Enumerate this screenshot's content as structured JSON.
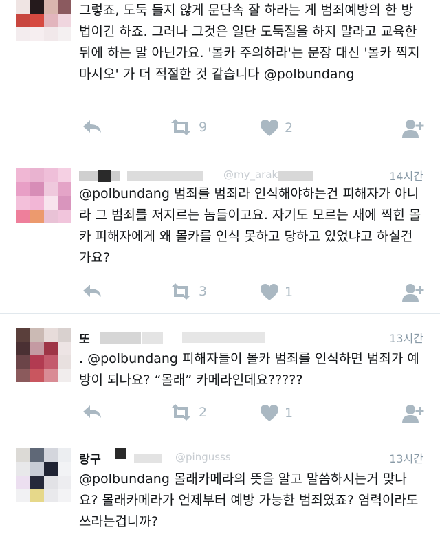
{
  "tweets": [
    {
      "text": "그렇죠, 도둑 들지 않게 문단속 잘 하라는 게 범죄예방의 한 방법이긴 하죠. 그러나 그것은 일단 도둑질을 하지 말라고 교육한 뒤에 하는 말 아닌가요. '몰카 주의하라'는 문장 대신 '몰카 찍지 마시오' 가 더 적절한 것 같습니다 @polbundang",
      "retweets": "9",
      "likes": "2"
    },
    {
      "name": "",
      "handle": "@my_arak",
      "time": "14시간",
      "text": "@polbundang 범죄를 범죄라 인식해야하는건 피해자가 아니라 그 범죄를 저지르는 놈들이고요. 자기도 모르는 새에 찍힌 몰카 피해자에게 왜 몰카를 인식 못하고 당하고 있었냐고 하실건가요?",
      "retweets": "3",
      "likes": "1"
    },
    {
      "name": "또",
      "time": "13시간",
      "text": ". @polbundang 피해자들이 몰카 범죄를 인식하면 범죄가 예방이 되나요? “몰래” 카메라인데요?????",
      "retweets": "2",
      "likes": "1"
    },
    {
      "name": "랑구",
      "handle": "@pingusss",
      "time": "13시간",
      "text": "@polbundang 몰래카메라의 뜻을 알고 말씀하시는거 맞나요? 몰래카메라가 언제부터 예방 가능한 범죄였죠? 염력이라도 쓰라는겁니까?"
    }
  ],
  "colors": {
    "icon": "#aab8c2",
    "text": "#14171a",
    "muted": "#8899a6",
    "divider": "#e1e8ed"
  },
  "icons": [
    "reply-icon",
    "retweet-icon",
    "like-icon",
    "follow-icon"
  ]
}
